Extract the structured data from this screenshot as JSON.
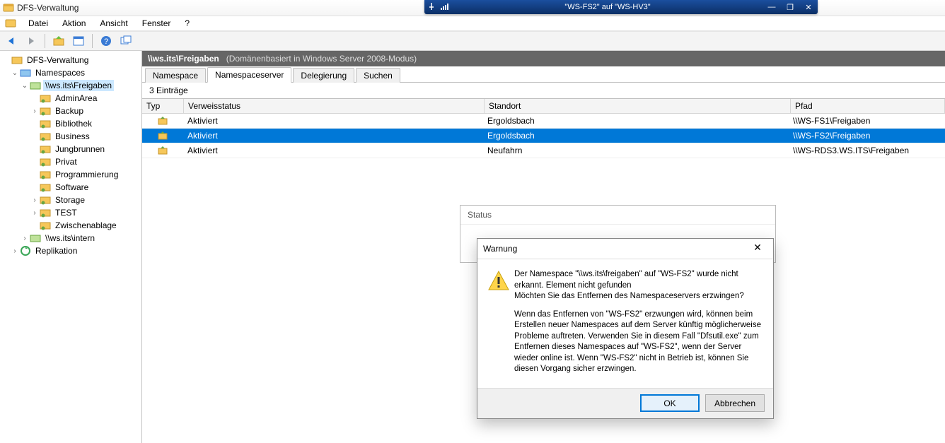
{
  "app": {
    "title": "DFS-Verwaltung"
  },
  "remote": {
    "title": "\"WS-FS2\" auf \"WS-HV3\""
  },
  "menu": {
    "items": [
      "Datei",
      "Aktion",
      "Ansicht",
      "Fenster",
      "?"
    ]
  },
  "tree": {
    "root": "DFS-Verwaltung",
    "ns_group": "Namespaces",
    "ns1": "\\\\ws.its\\Freigaben",
    "items": [
      "AdminArea",
      "Backup",
      "Bibliothek",
      "Business",
      "Jungbrunnen",
      "Privat",
      "Programmierung",
      "Software",
      "Storage",
      "TEST",
      "Zwischenablage"
    ],
    "ns2": "\\\\ws.its\\intern",
    "repl": "Replikation"
  },
  "path": {
    "main": "\\\\ws.its\\Freigaben",
    "sub": "(Domänenbasiert in Windows Server 2008-Modus)"
  },
  "tabs": {
    "items": [
      "Namespace",
      "Namespaceserver",
      "Delegierung",
      "Suchen"
    ],
    "active": 1
  },
  "grid": {
    "count": "3 Einträge",
    "headers": [
      "Typ",
      "Verweisstatus",
      "Standort",
      "Pfad"
    ],
    "rows": [
      {
        "status": "Aktiviert",
        "site": "Ergoldsbach",
        "path": "\\\\WS-FS1\\Freigaben",
        "sel": false
      },
      {
        "status": "Aktiviert",
        "site": "Ergoldsbach",
        "path": "\\\\WS-FS2\\Freigaben",
        "sel": true
      },
      {
        "status": "Aktiviert",
        "site": "Neufahrn",
        "path": "\\\\WS-RDS3.WS.ITS\\Freigaben",
        "sel": false
      }
    ]
  },
  "status": {
    "title": "Status"
  },
  "dialog": {
    "title": "Warnung",
    "p1": "Der Namespace \"\\\\ws.its\\freigaben\" auf \"WS-FS2\" wurde nicht erkannt. Element nicht gefunden",
    "p2": "Möchten Sie das Entfernen des Namespaceservers erzwingen?",
    "p3": "Wenn das Entfernen von \"WS-FS2\" erzwungen wird, können beim Erstellen neuer Namespaces auf dem Server künftig möglicherweise Probleme auftreten. Verwenden Sie in diesem Fall \"Dfsutil.exe\" zum Entfernen dieses Namespaces auf \"WS-FS2\", wenn der Server wieder online ist. Wenn \"WS-FS2\" nicht in Betrieb ist, können Sie diesen Vorgang sicher erzwingen.",
    "ok": "OK",
    "cancel": "Abbrechen"
  }
}
